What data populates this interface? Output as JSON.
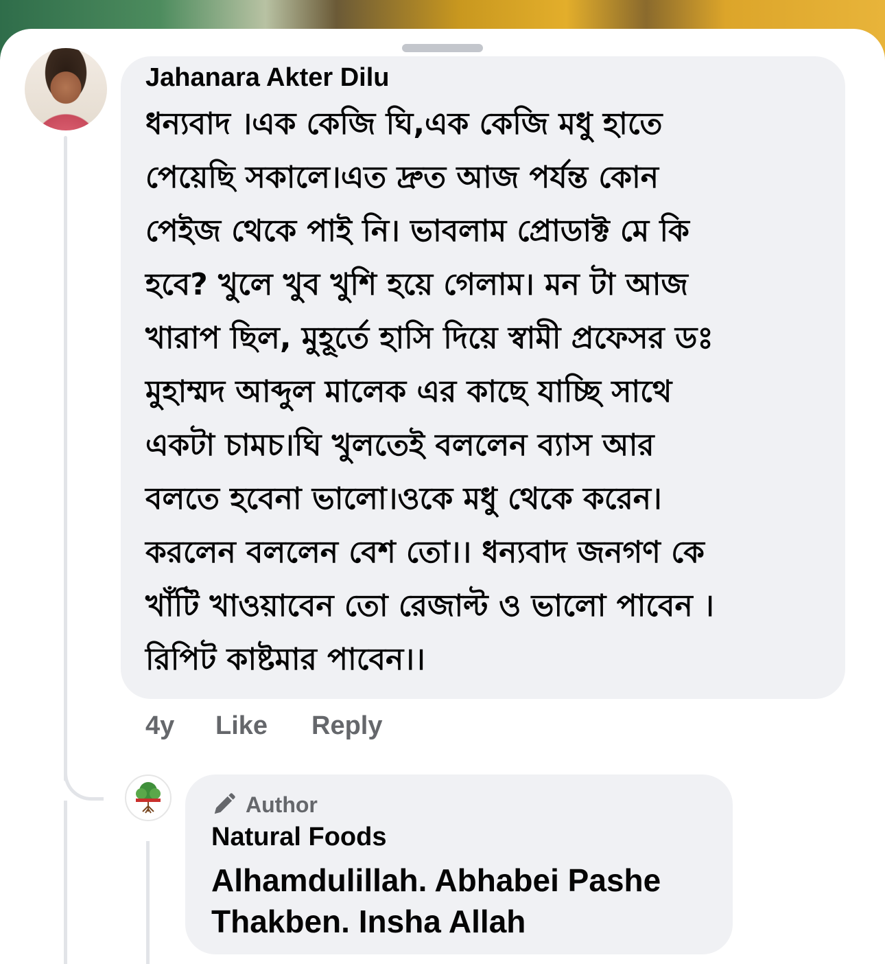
{
  "comment": {
    "author": "Jahanara Akter Dilu",
    "lines": [
      "ধন্যবাদ ।এক কেজি ঘি,এক কেজি মধু হাতে",
      "পেয়েছি সকালে।এত দ্রুত আজ পর্যন্ত কোন",
      "পেইজ থেকে পাই নি। ভাবলাম প্রোডাক্ট মে কি",
      "হবে? খুলে খুব খুশি হয়ে গেলাম। মন টা আজ",
      "খারাপ ছিল, মুহূর্তে হাসি দিয়ে স্বামী প্রফেসর ডঃ",
      "মুহাম্মদ আব্দুল মালেক এর কাছে যাচ্ছি সাথে",
      "একটা চামচ।ঘি খুলতেই বললেন ব্যাস আর",
      "বলতে হবেনা ভালো।ওকে মধু থেকে করেন।",
      "করলেন বললেন বেশ তো।। ধন্যবাদ জনগণ কে",
      "খাঁটি খাওয়াবেন তো রেজাল্ট ও ভালো পাবেন ।",
      "রিপিট কাষ্টমার পাবেন।।"
    ],
    "time": "4y",
    "like_label": "Like",
    "reply_label": "Reply"
  },
  "reply": {
    "badge": "Author",
    "badge_icon": "pencil-icon",
    "author": "Natural Foods",
    "lines": [
      "Alhamdulillah. Abhabei Pashe",
      "Thakben. Insha Allah"
    ]
  },
  "colors": {
    "bubble": "#f0f1f4",
    "text": "#050505",
    "secondary": "#65676b",
    "thread_line": "#e2e4e8"
  }
}
